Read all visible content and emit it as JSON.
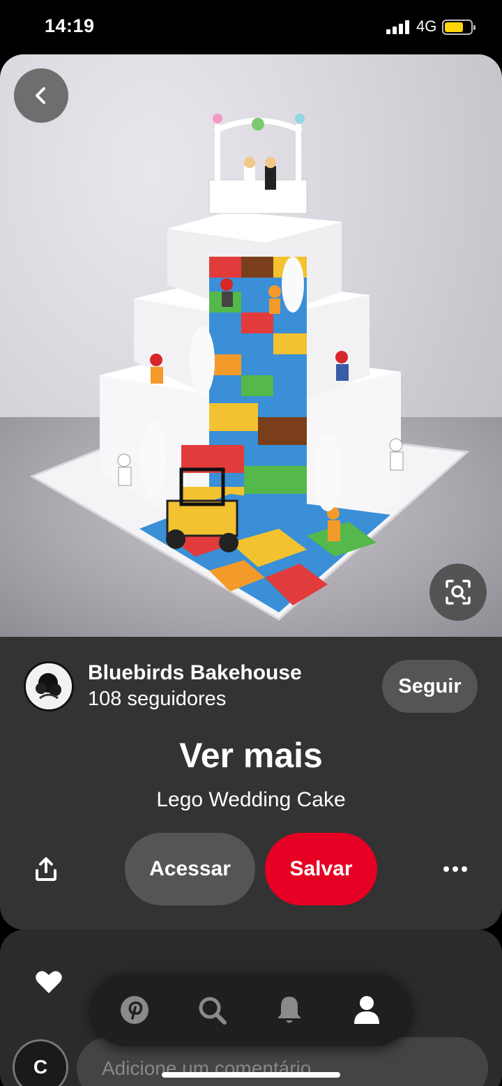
{
  "status_bar": {
    "time": "14:19",
    "network": "4G",
    "battery_color": "#ffd60a"
  },
  "pin": {
    "image_alt": "Lego wedding cake",
    "back_icon": "chevron-left-icon",
    "lens_icon": "visual-search-icon"
  },
  "creator": {
    "name": "Bluebirds Bakehouse",
    "followers": "108 seguidores",
    "follow_label": "Seguir"
  },
  "content": {
    "see_more": "Ver mais",
    "title": "Lego Wedding Cake"
  },
  "actions": {
    "share_icon": "share-icon",
    "visit_label": "Acessar",
    "save_label": "Salvar",
    "more_icon": "more-dots-icon",
    "save_color": "#e60023"
  },
  "comments": {
    "avatar_initial": "C",
    "placeholder": "Adicione um comentário"
  },
  "nav": {
    "items": [
      "pinterest-icon",
      "search-icon",
      "bell-icon",
      "profile-icon"
    ]
  }
}
